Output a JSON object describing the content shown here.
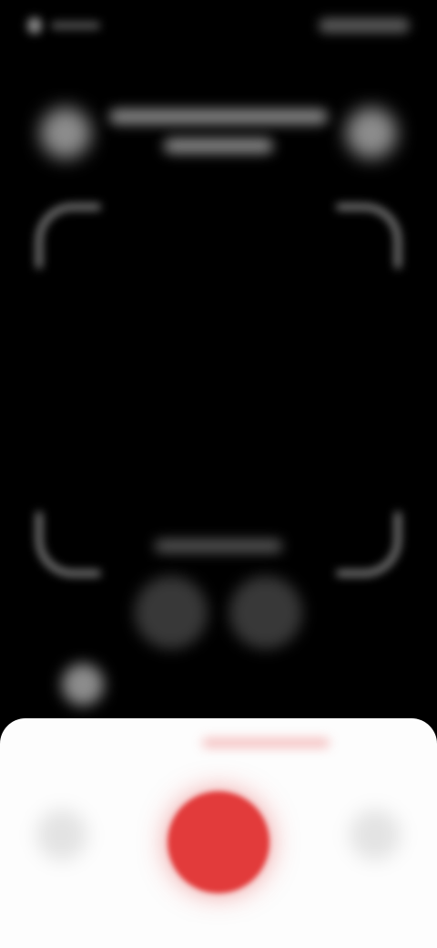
{
  "status_bar": {
    "left_icon": "status-indicator-icon",
    "right_icons": "system-status-icons"
  },
  "header": {
    "title": "",
    "subtitle": "",
    "left_icon": "close-icon",
    "right_icon": "settings-icon"
  },
  "viewfinder": {
    "frame_icon": "scan-frame-icon"
  },
  "controls": {
    "hint": "",
    "modes": [
      {
        "icon": "mode-left-icon"
      },
      {
        "icon": "mode-right-icon"
      }
    ],
    "thumbnail_icon": "gallery-thumbnail-icon"
  },
  "bottom_sheet": {
    "hint": "",
    "left_icon": "left-action-icon",
    "right_icon": "right-action-icon",
    "record_color": "#e23b3b",
    "record_icon": "record-icon"
  },
  "colors": {
    "background": "#000000",
    "sheet": "#fdfdfd",
    "accent": "#e23b3b"
  }
}
